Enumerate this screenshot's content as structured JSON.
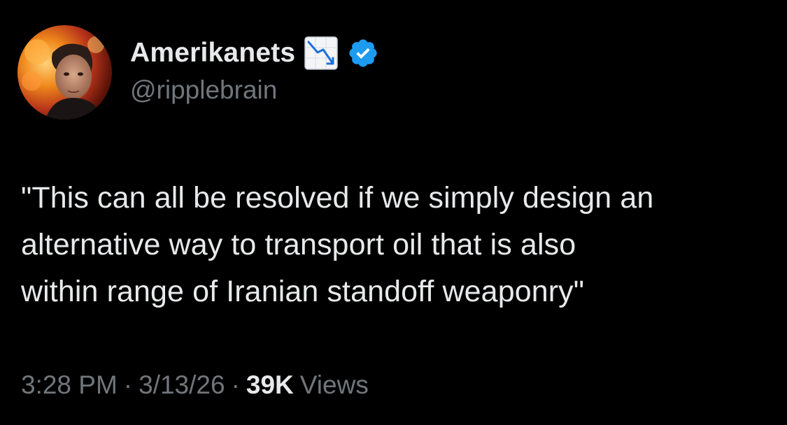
{
  "author": {
    "display_name": "Amerikanets",
    "handle": "@ripplebrain",
    "name_emoji": "chart-decreasing-emoji",
    "verified_badge": "verified-badge-icon",
    "avatar": "avatar-photo"
  },
  "tweet": {
    "lines": [
      "\"This can all be resolved if we simply design an",
      "alternative way to transport oil that is also",
      "within range of Iranian standoff weaponry\""
    ]
  },
  "meta": {
    "time": "3:28 PM",
    "separator": "·",
    "date": "3/13/26",
    "views_count": "39K",
    "views_label": "Views"
  },
  "colors": {
    "background": "#000000",
    "primary_text": "#e7e9ea",
    "secondary_text": "#71767b",
    "verified_blue": "#1d9bf0"
  }
}
